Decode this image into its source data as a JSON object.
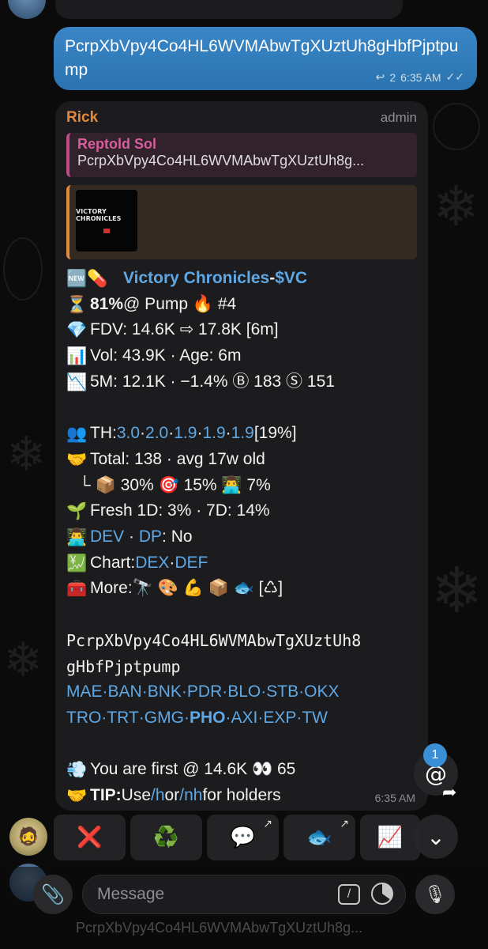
{
  "outgoing": {
    "text": "PcrpXbVpy4Co4HL6WVMAbwTgXUztUh8gHbfPjptpump",
    "reply_count": "2",
    "time": "6:35 AM",
    "read_icon": "double-check-icon"
  },
  "message": {
    "sender": "Rick",
    "role": "admin",
    "reply": {
      "name": "Reptold Sol",
      "text": "PcrpXbVpy4Co4HL6WVMAbwTgXUztUh8g..."
    },
    "preview_title": "VICTORY CHRONICLES",
    "lines": {
      "title_link": "Victory Chronicles",
      "title_sep": " - ",
      "title_ticker": "$VC",
      "pump_pct": "81%",
      "pump_rest": " @ Pump 🔥 #4",
      "fdv": "FDV: 14.6K ⇨ 17.8K [6m]",
      "vol": "Vol: 43.9K · Age: 6m",
      "m5": "5M: 12.1K · −1.4% Ⓑ 183 Ⓢ 151",
      "th_label": "TH: ",
      "th_values": [
        "3.0",
        "2.0",
        "1.9",
        "1.9",
        "1.9"
      ],
      "th_pct": " [19%]",
      "total": "Total: 138 · avg 17w old",
      "sub_holders": "└ 📦 30% 🎯 15% 👨‍💻 7%",
      "fresh": "Fresh 1D: 3% · 7D: 14%",
      "dev_link": "DEV",
      "dp_link": "DP",
      "dp_value": ": No",
      "chart_label": "Chart: ",
      "chart_links": [
        "DEX",
        "DEF"
      ],
      "more_label": "More: ",
      "more_icons": "🔭 🎨 💪 📦 🐟 [♺]",
      "ca_line1": "PcrpXbVpy4Co4HL6WVMAbwTgXUztUh8",
      "ca_line2": "gHbfPjptpump",
      "links_row1": [
        "MAE",
        "BAN",
        "BNK",
        "PDR",
        "BLO",
        "STB",
        "OKX"
      ],
      "links_row2": [
        "TRO",
        "TRT",
        "GMG",
        "PHO",
        "AXI",
        "EXP",
        "TW"
      ],
      "first": "You are first @ 14.6K 👀 65",
      "tip_label": "TIP:",
      "tip_pre": " Use ",
      "tip_h": "/h",
      "tip_mid": " or ",
      "tip_nh": "/nh",
      "tip_post": " for holders"
    },
    "emojis": {
      "new": "🆕💊",
      "hourglass": "⏳",
      "diamond": "💎",
      "bar": "📊",
      "down": "📉",
      "people": "👥",
      "handshake": "🤝",
      "seedling": "🌱",
      "dev": "👨‍💻",
      "chart": "💹",
      "toolbox": "🧰",
      "dash": "💨",
      "tip": "🤝"
    },
    "time": "6:35 AM"
  },
  "keyboard": [
    {
      "label": "❌",
      "icon": "cross-icon",
      "external": false
    },
    {
      "label": "♻️",
      "icon": "recycle-icon",
      "external": false
    },
    {
      "label": "💬",
      "icon": "speech-bubble-icon",
      "external": true
    },
    {
      "label": "🐟",
      "icon": "fish-icon",
      "external": true
    },
    {
      "label": "📈",
      "icon": "chart-up-icon",
      "external": true
    }
  ],
  "mention_badge": "1",
  "composer": {
    "placeholder": "Message"
  }
}
